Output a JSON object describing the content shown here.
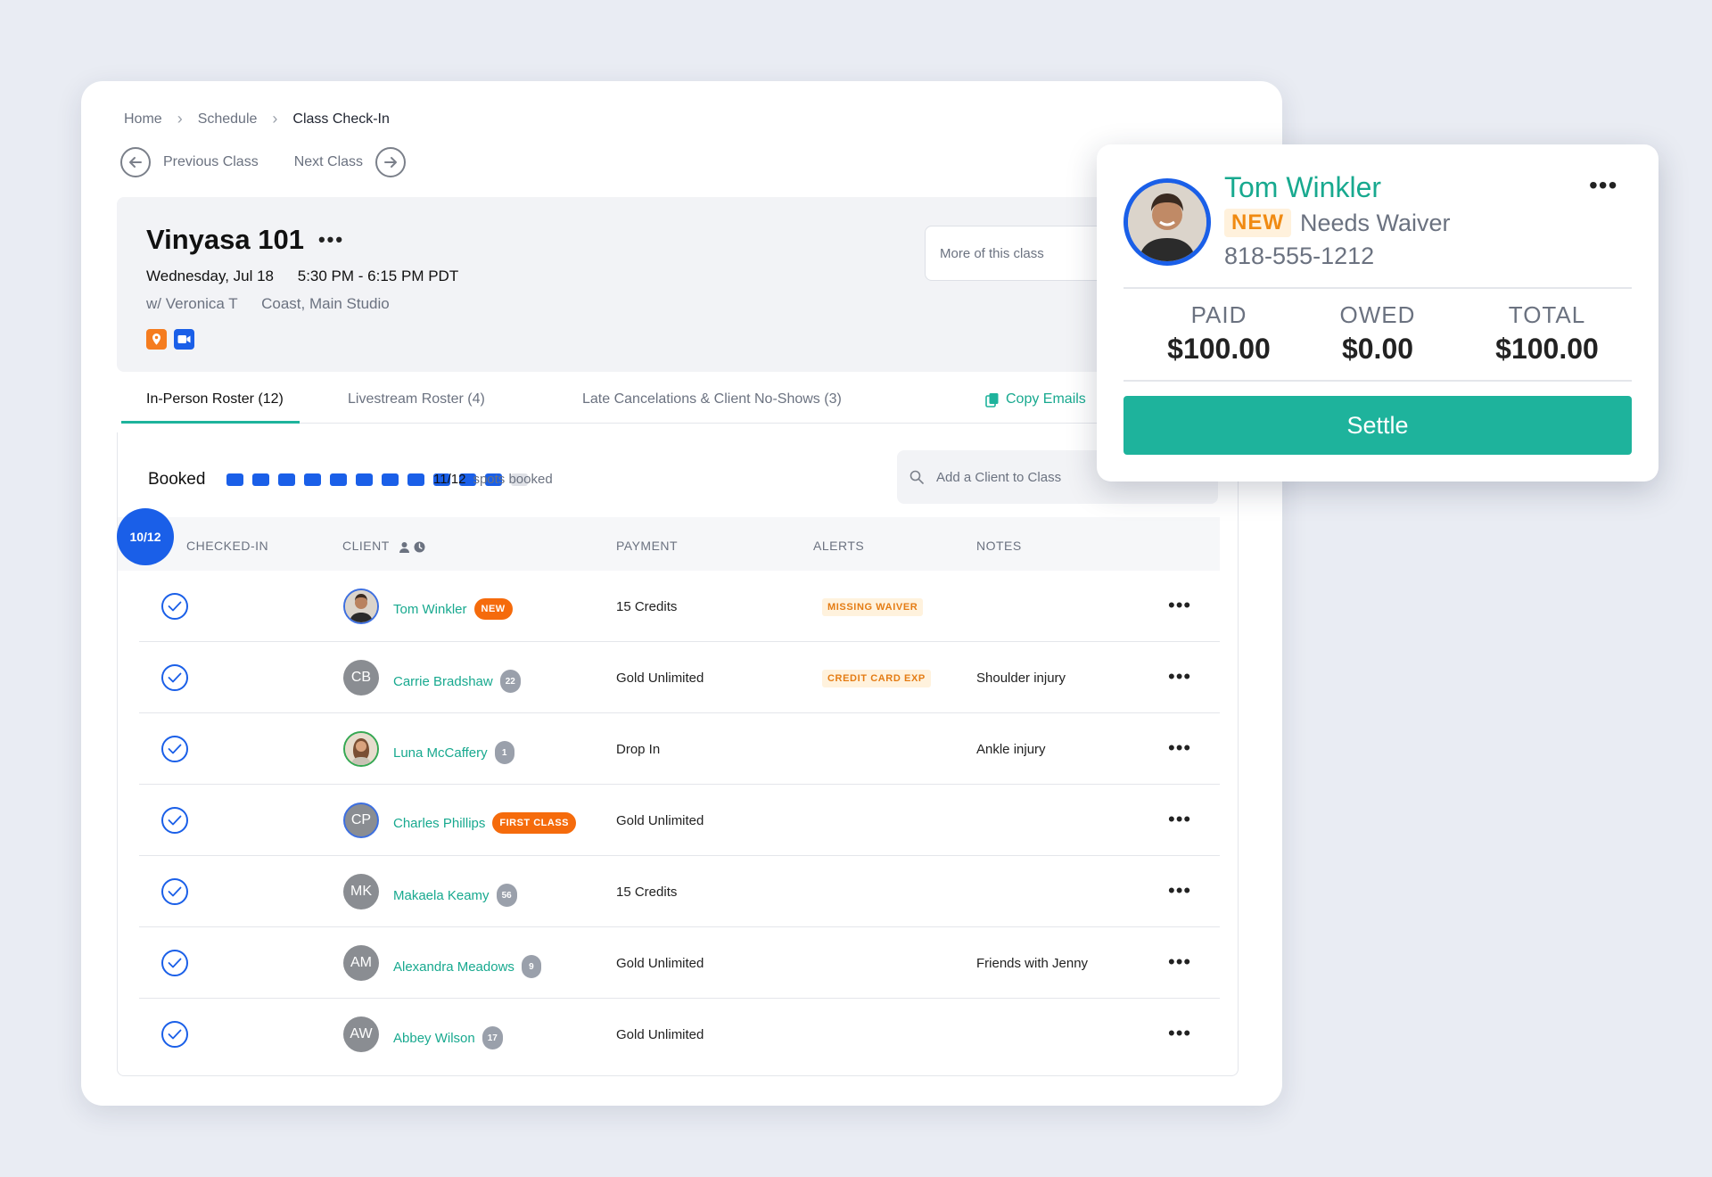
{
  "breadcrumb": {
    "home": "Home",
    "schedule": "Schedule",
    "current": "Class Check-In"
  },
  "nav": {
    "previous": "Previous Class",
    "next": "Next Class"
  },
  "class_info": {
    "title": "Vinyasa 101",
    "date": "Wednesday, Jul 18",
    "time": "5:30 PM - 6:15 PM PDT",
    "instructor": "w/ Veronica T",
    "location": "Coast, Main Studio",
    "more_placeholder": "More of this class"
  },
  "tabs": {
    "in_person": "In-Person Roster (12)",
    "livestream": "Livestream Roster (4)",
    "late": "Late Cancelations & Client No-Shows (3)",
    "copy_emails": "Copy Emails"
  },
  "booking": {
    "label": "Booked",
    "booked": 11,
    "capacity": 12,
    "count_text": "11/12",
    "spots_text": "spots booked",
    "add_placeholder": "Add a Client to Class"
  },
  "table": {
    "checked_count": "10/12",
    "headers": {
      "checked_in": "CHECKED-IN",
      "client": "CLIENT",
      "payment": "PAYMENT",
      "alerts": "ALERTS",
      "notes": "NOTES"
    },
    "rows": [
      {
        "initials": "",
        "name": "Tom Winkler",
        "tag": "NEW",
        "payment": "15 Credits",
        "alert": "MISSING WAIVER",
        "note": ""
      },
      {
        "initials": "CB",
        "name": "Carrie Bradshaw",
        "tag": "22",
        "payment": "Gold Unlimited",
        "alert": "CREDIT CARD EXP",
        "note": "Shoulder injury"
      },
      {
        "initials": "",
        "name": "Luna McCaffery",
        "tag": "1",
        "payment": "Drop In",
        "alert": "",
        "note": "Ankle injury"
      },
      {
        "initials": "CP",
        "name": "Charles Phillips",
        "tag": "FIRST CLASS",
        "payment": "Gold Unlimited",
        "alert": "",
        "note": ""
      },
      {
        "initials": "MK",
        "name": "Makaela Keamy",
        "tag": "56",
        "payment": "15 Credits",
        "alert": "",
        "note": ""
      },
      {
        "initials": "AM",
        "name": "Alexandra Meadows",
        "tag": "9",
        "payment": "Gold Unlimited",
        "alert": "",
        "note": "Friends with Jenny"
      },
      {
        "initials": "AW",
        "name": "Abbey Wilson",
        "tag": "17",
        "payment": "Gold Unlimited",
        "alert": "",
        "note": ""
      }
    ]
  },
  "popup": {
    "name": "Tom Winkler",
    "new_tag": "NEW",
    "status": "Needs Waiver",
    "phone": "818-555-1212",
    "paid_label": "PAID",
    "paid_value": "$100.00",
    "owed_label": "OWED",
    "owed_value": "$0.00",
    "total_label": "TOTAL",
    "total_value": "$100.00",
    "settle": "Settle"
  },
  "colors": {
    "accent_teal": "#1eb39c",
    "brand_blue": "#1a5fe8",
    "alert_orange": "#f56b0c"
  }
}
